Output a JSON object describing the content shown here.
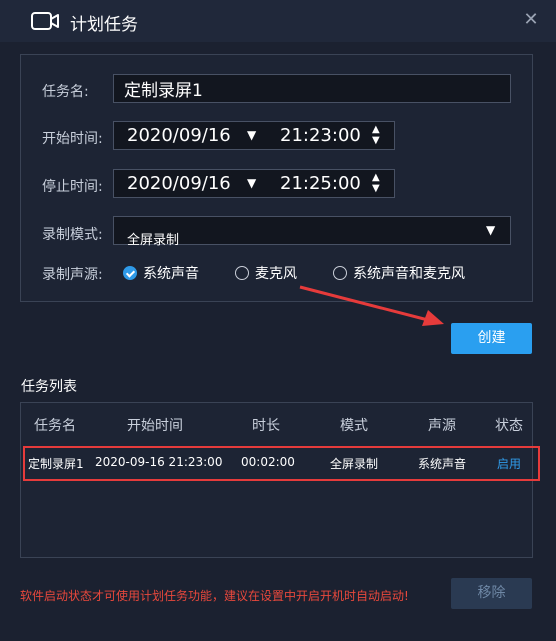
{
  "window": {
    "title": "计划任务",
    "icons": {
      "app": "camera-icon",
      "close": "close-icon"
    }
  },
  "form": {
    "task_name_label": "任务名:",
    "task_name_value": "定制录屏1",
    "start_time_label": "开始时间:",
    "start_date": "2020/09/16",
    "start_time": "21:23:00",
    "stop_time_label": "停止时间:",
    "stop_date": "2020/09/16",
    "stop_time": "21:25:00",
    "mode_label": "录制模式:",
    "mode_value": "全屏录制",
    "audio_label": "录制声源:",
    "audio_options": [
      {
        "label": "系统声音",
        "checked": true
      },
      {
        "label": "麦克风",
        "checked": false
      },
      {
        "label": "系统声音和麦克风",
        "checked": false
      }
    ]
  },
  "create_button": "创建",
  "task_list": {
    "title": "任务列表",
    "columns": [
      "任务名",
      "开始时间",
      "时长",
      "模式",
      "声源",
      "状态"
    ],
    "rows": [
      [
        "定制录屏1",
        "2020-09-16 21:23:00",
        "00:02:00",
        "全屏录制",
        "系统声音",
        "启用"
      ]
    ]
  },
  "footer": {
    "warning": "软件启动状态才可使用计划任务功能，建议在设置中开启开机时自动启动!",
    "remove_button": "移除"
  },
  "colors": {
    "accent": "#2a9ff0",
    "highlight": "#e63b3b",
    "warning": "#e8483c"
  }
}
